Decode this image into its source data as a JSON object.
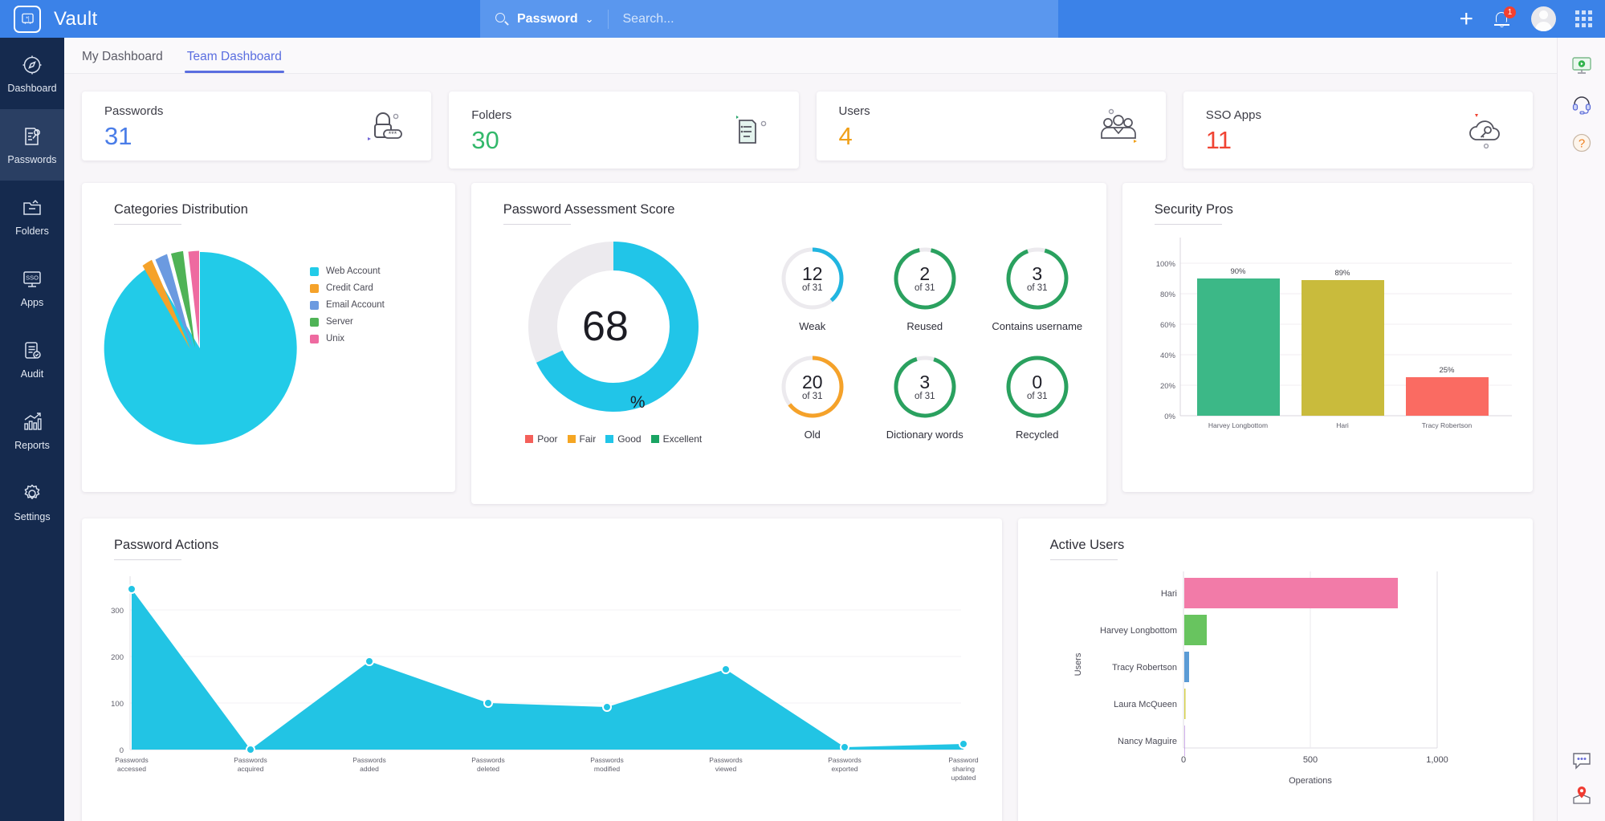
{
  "app": {
    "brand": "Vault",
    "logo_icon": "vault-badge-icon"
  },
  "search": {
    "scope_label": "Password",
    "placeholder": "Search...",
    "value": "",
    "search_icon": "search-icon",
    "chevron": "⌄"
  },
  "header_actions": {
    "add_label": "+",
    "notification_count": "1",
    "bell_icon": "bell-icon",
    "avatar_icon": "avatar-icon",
    "apps_grid_icon": "grid-icon"
  },
  "sidebar": {
    "items": [
      {
        "label": "Dashboard",
        "icon": "compass-icon",
        "active": false
      },
      {
        "label": "Passwords",
        "icon": "key-document-icon",
        "active": true
      },
      {
        "label": "Folders",
        "icon": "folder-icon",
        "active": false
      },
      {
        "label": "Apps",
        "icon": "sso-monitor-icon",
        "active": false
      },
      {
        "label": "Audit",
        "icon": "clipboard-check-icon",
        "active": false
      },
      {
        "label": "Reports",
        "icon": "bar-chart-arrow-icon",
        "active": false
      },
      {
        "label": "Settings",
        "icon": "gear-icon",
        "active": false
      }
    ]
  },
  "tabs": [
    {
      "label": "My Dashboard",
      "active": false
    },
    {
      "label": "Team Dashboard",
      "active": true
    }
  ],
  "stat_cards": [
    {
      "label": "Passwords",
      "value": "31",
      "color": "#4a7de8",
      "icon": "padlock-asterisk-icon"
    },
    {
      "label": "Folders",
      "value": "30",
      "color": "#33b86b",
      "icon": "folder-list-icon"
    },
    {
      "label": "Users",
      "value": "4",
      "color": "#f0a019",
      "icon": "users-group-icon"
    },
    {
      "label": "SSO Apps",
      "value": "11",
      "color": "#f04433",
      "icon": "cloud-key-icon"
    }
  ],
  "panels": {
    "categories": {
      "title": "Categories Distribution"
    },
    "assessment": {
      "title": "Password Assessment Score"
    },
    "security_pros": {
      "title": "Security Pros"
    },
    "password_actions": {
      "title": "Password Actions"
    },
    "active_users": {
      "title": "Active Users"
    }
  },
  "assessment": {
    "score_value": "68",
    "score_unit": "%",
    "legend": [
      {
        "label": "Poor",
        "color": "#f4605a"
      },
      {
        "label": "Fair",
        "color": "#f5a623"
      },
      {
        "label": "Good",
        "color": "#21c5e8"
      },
      {
        "label": "Excellent",
        "color": "#1aa463"
      }
    ],
    "gauges": [
      {
        "label": "Weak",
        "value": "12",
        "of": "of 31",
        "pct": 38.7,
        "color": "#21b5e0"
      },
      {
        "label": "Reused",
        "value": "2",
        "of": "of 31",
        "pct": 93.5,
        "color": "#2aa15f"
      },
      {
        "label": "Contains username",
        "value": "3",
        "of": "of 31",
        "pct": 90.3,
        "color": "#2aa15f"
      },
      {
        "label": "Old",
        "value": "20",
        "of": "of 31",
        "pct": 64.5,
        "color": "#f5a22a"
      },
      {
        "label": "Dictionary words",
        "value": "3",
        "of": "of 31",
        "pct": 90.3,
        "color": "#2aa15f"
      },
      {
        "label": "Recycled",
        "value": "0",
        "of": "of 31",
        "pct": 100,
        "color": "#2aa15f"
      }
    ]
  },
  "chart_data": [
    {
      "type": "pie",
      "title": "Categories Distribution",
      "legend_position": "right",
      "categories": [
        "Web Account",
        "Credit Card",
        "Email Account",
        "Server",
        "Unix"
      ],
      "values": [
        84,
        4,
        4,
        4,
        4
      ],
      "colors": [
        "#22cbe8",
        "#f5a22a",
        "#6b9ae0",
        "#4fb356",
        "#ee6aa0"
      ]
    },
    {
      "type": "bar",
      "title": "Security Pros",
      "categories": [
        "Harvey Longbottom",
        "Hari",
        "Tracy Robertson"
      ],
      "values": [
        90,
        89,
        25
      ],
      "value_labels": [
        "90%",
        "89%",
        "25%"
      ],
      "colors": [
        "#3cb887",
        "#c9bb3c",
        "#fa6b62"
      ],
      "ylabel": "",
      "xlabel": "",
      "ylim": [
        0,
        110
      ],
      "yticks": [
        "0%",
        "20%",
        "40%",
        "60%",
        "80%",
        "100%"
      ],
      "grid": true
    },
    {
      "type": "area",
      "title": "Password Actions",
      "categories": [
        "Passwords accessed",
        "Passwords acquired",
        "Passwords added",
        "Passwords deleted",
        "Passwords modified",
        "Passwords viewed",
        "Passwords exported",
        "Password sharing updated"
      ],
      "values": [
        345,
        0,
        190,
        100,
        92,
        172,
        5,
        12
      ],
      "color": "#22c4e4",
      "ylim": [
        0,
        360
      ],
      "yticks": [
        "0",
        "100",
        "200",
        "300"
      ],
      "xlabel": "",
      "ylabel": "",
      "grid": true
    },
    {
      "type": "bar",
      "orientation": "horizontal",
      "title": "Active Users",
      "categories": [
        "Hari",
        "Harvey Longbottom",
        "Tracy Robertson",
        "Laura McQueen",
        "Nancy Maguire"
      ],
      "values": [
        960,
        105,
        18,
        3,
        0
      ],
      "colors": [
        "#f27ba8",
        "#68c45f",
        "#5b9bd5",
        "#d4cf4a",
        "#b27ce0"
      ],
      "xlabel": "Operations",
      "ylabel": "Users",
      "xlim": [
        0,
        1100
      ],
      "xticks": [
        "0",
        "500",
        "1,000"
      ],
      "grid": true
    }
  ],
  "rail": {
    "top_icons": [
      {
        "name": "screen-share-icon"
      },
      {
        "name": "headset-support-icon"
      },
      {
        "name": "help-question-icon"
      }
    ],
    "bottom_icons": [
      {
        "name": "chat-bubble-icon"
      },
      {
        "name": "location-pin-icon"
      }
    ]
  }
}
